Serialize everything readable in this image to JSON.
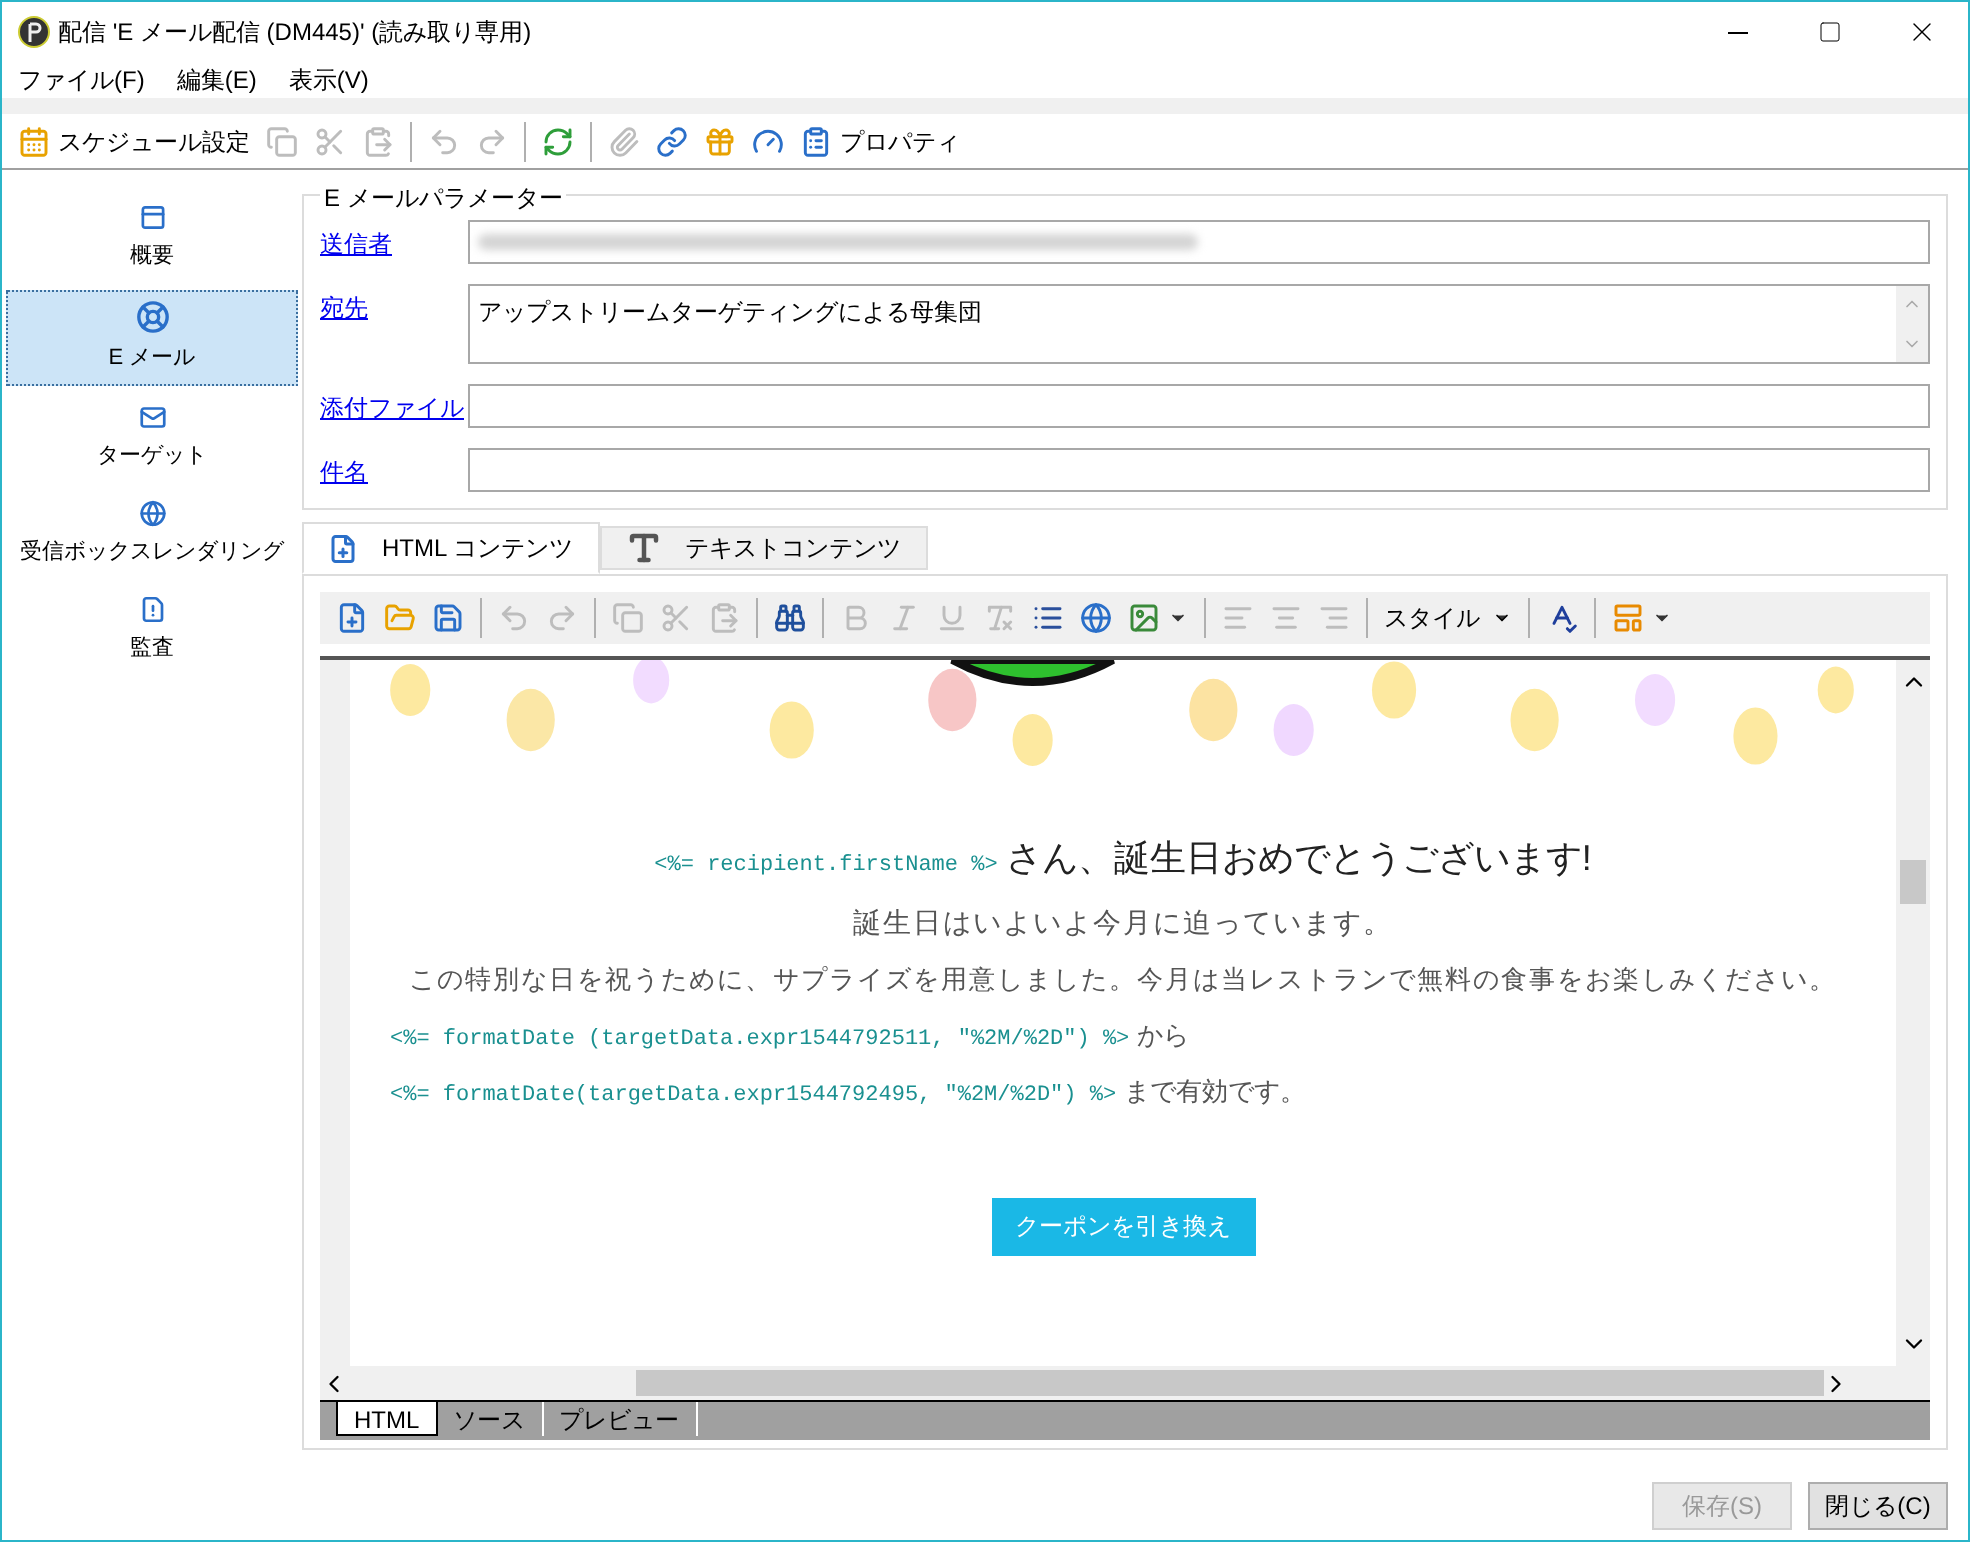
{
  "window": {
    "title": "配信 'E メール配信 (DM445)' (読み取り専用)"
  },
  "menu": [
    "ファイル(F)",
    "編集(E)",
    "表示(V)"
  ],
  "toolbar": [
    {
      "kind": "button",
      "label": "スケジュール設定",
      "disabled": false
    },
    {
      "kind": "button",
      "disabled": true
    },
    {
      "kind": "button",
      "disabled": true
    },
    {
      "kind": "button",
      "disabled": true
    },
    {
      "kind": "separator"
    },
    {
      "kind": "button",
      "disabled": true
    },
    {
      "kind": "button",
      "disabled": true
    },
    {
      "kind": "separator"
    },
    {
      "kind": "button",
      "disabled": false
    },
    {
      "kind": "separator"
    },
    {
      "kind": "button",
      "disabled": true
    },
    {
      "kind": "button",
      "disabled": false
    },
    {
      "kind": "button",
      "disabled": false
    },
    {
      "kind": "button",
      "disabled": false
    },
    {
      "kind": "button",
      "label": "プロパティ",
      "disabled": false
    }
  ],
  "sidebar": {
    "items": [
      {
        "label": "概要",
        "selected": false
      },
      {
        "label": "E メール",
        "selected": true
      },
      {
        "label": "ターゲット",
        "selected": false
      },
      {
        "label": "受信ボックスレンダリング",
        "selected": false
      },
      {
        "label": "監査",
        "selected": false
      }
    ]
  },
  "parameters": {
    "title": "E メールパラメーター",
    "fields": [
      {
        "label": "送信者",
        "kind": "blurred"
      },
      {
        "label": "宛先",
        "kind": "multiline",
        "value": "アップストリームターゲティングによる母集団"
      },
      {
        "label": "添付ファイル",
        "kind": "text"
      },
      {
        "label": "件名",
        "kind": "text"
      }
    ]
  },
  "content_tabs": [
    {
      "label": "HTML コンテンツ",
      "selected": true
    },
    {
      "label": "テキストコンテンツ",
      "selected": false
    }
  ],
  "editor_toolbar": [
    {
      "kind": "button",
      "disabled": false
    },
    {
      "kind": "button",
      "disabled": false
    },
    {
      "kind": "button",
      "disabled": false
    },
    {
      "kind": "separator"
    },
    {
      "kind": "button",
      "disabled": true
    },
    {
      "kind": "button",
      "disabled": true
    },
    {
      "kind": "separator"
    },
    {
      "kind": "button",
      "disabled": true
    },
    {
      "kind": "button",
      "disabled": true
    },
    {
      "kind": "button",
      "disabled": true
    },
    {
      "kind": "separator"
    },
    {
      "kind": "button",
      "disabled": false
    },
    {
      "kind": "separator"
    },
    {
      "kind": "button",
      "disabled": true
    },
    {
      "kind": "button",
      "disabled": true
    },
    {
      "kind": "button",
      "disabled": true
    },
    {
      "kind": "button",
      "disabled": true
    },
    {
      "kind": "button",
      "disabled": false
    },
    {
      "kind": "button",
      "disabled": false
    },
    {
      "kind": "dropdown",
      "disabled": false
    },
    {
      "kind": "separator"
    },
    {
      "kind": "button",
      "disabled": true
    },
    {
      "kind": "button",
      "disabled": true
    },
    {
      "kind": "button",
      "disabled": true
    },
    {
      "kind": "separator"
    },
    {
      "kind": "select",
      "label": "スタイル",
      "disabled": false
    },
    {
      "kind": "separator"
    },
    {
      "kind": "button",
      "disabled": false
    },
    {
      "kind": "separator"
    },
    {
      "kind": "dropdown",
      "disabled": false
    }
  ],
  "email": {
    "lines": [
      {
        "kind": "heading",
        "code": "<%= recipient.firstName %>",
        "text": "さん、誕生日おめでとうございます!"
      },
      {
        "kind": "subtitle",
        "text": "誕生日はいよいよ今月に迫っています。"
      },
      {
        "kind": "paragraph",
        "text": "この特別な日を祝うために、サプライズを用意しました。今月は当レストランで無料の食事をお楽しみください。"
      },
      {
        "kind": "code_line",
        "code": "<%= formatDate (targetData.expr1544792511, \"%2M/%2D\") %>",
        "text": "から"
      },
      {
        "kind": "code_line",
        "code": "<%= formatDate(targetData.expr1544792495, \"%2M/%2D\") %>",
        "text": "まで有効です。"
      }
    ],
    "button": "クーポンを引き換え"
  },
  "view_tabs": [
    {
      "label": "HTML",
      "selected": true
    },
    {
      "label": "ソース",
      "selected": false
    },
    {
      "label": "プレビュー",
      "selected": false
    }
  ],
  "buttons": [
    {
      "label": "保存(S)",
      "disabled": true
    },
    {
      "label": "閉じる(C)",
      "disabled": false
    }
  ]
}
